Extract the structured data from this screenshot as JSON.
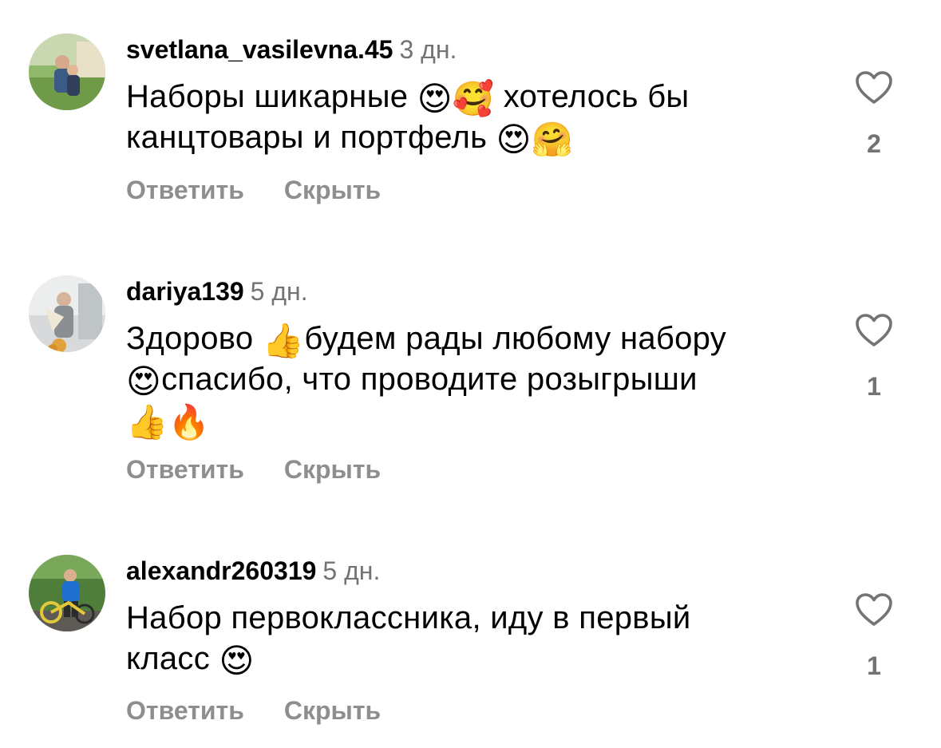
{
  "comments": [
    {
      "username": "svetlana_vasilevna.45",
      "time": "3 дн.",
      "text_parts": [
        "Наборы шикарные ",
        "😍🥰",
        " хотелось бы",
        "канцтовары и портфель ",
        "😍🤗"
      ],
      "like_count": "2",
      "actions": {
        "reply": "Ответить",
        "hide": "Скрыть"
      }
    },
    {
      "username": "dariya139",
      "time": "5 дн.",
      "text_parts": [
        "Здорово ",
        "👍",
        "будем рады любому набору",
        "😍",
        "спасибо, что проводите розыгрыши",
        "👍🔥"
      ],
      "like_count": "1",
      "actions": {
        "reply": "Ответить",
        "hide": "Скрыть"
      }
    },
    {
      "username": "alexandr260319",
      "time": "5 дн.",
      "text_parts": [
        "Набор первоклассника, иду в первый",
        "класс ",
        "😍"
      ],
      "like_count": "1",
      "actions": {
        "reply": "Ответить",
        "hide": "Скрыть"
      }
    }
  ],
  "icons": {
    "like": "heart-outline-icon"
  },
  "colors": {
    "secondary_text": "#737373",
    "action_text": "#8e8e8e",
    "primary_text": "#000000"
  }
}
